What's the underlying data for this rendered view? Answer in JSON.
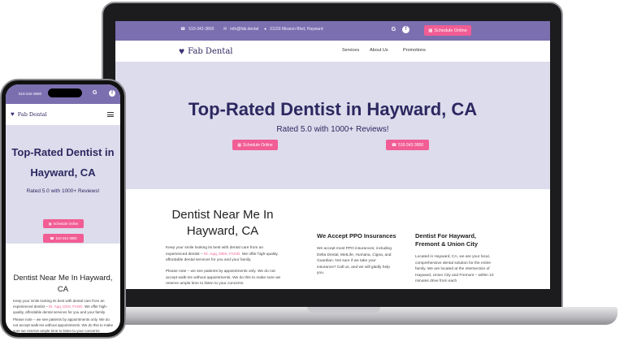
{
  "site": {
    "logo_name": "Fab Dental",
    "phone": "510-342-3800",
    "email": "info@fab.dental",
    "address": "31150 Mission Blvd, Hayward",
    "social": {
      "google": "G",
      "facebook": "f"
    },
    "schedule_label": "Schedule Online"
  },
  "nav": {
    "services": "Services",
    "about": "About Us",
    "promotions": "Promotions"
  },
  "hero": {
    "title": "Top-Rated Dentist in Hayward, CA",
    "title_line1": "Top-Rated Dentist in",
    "title_line2": "Hayward, CA",
    "subtitle": "Rated 5.0 with 1000+ Reviews!",
    "schedule_button": "Schedule Online",
    "phone_button": "510-342-3800"
  },
  "content": {
    "heading_line1": "Dentist Near Me In",
    "heading_line2": "Hayward, CA",
    "phone_heading_line1": "Dentist Near Me In Hayward,",
    "phone_heading_line2": "CA",
    "para1_a": "Keep your smile looking its best with dental care from an experienced dentist –",
    "para1_link": "Dr. Aqq, DDS, FAGD.",
    "para1_b": "We offer high-quality, affordable dental services for you and your family.",
    "para2": "Please note – we see patients by appointments only. We do not accept walk-ins without appointments. We do this to make sure we reserve ample time to listen to your concerns",
    "ppo_heading": "We Accept PPO Insurances",
    "ppo_text": "We accept most PPO insurances, including Delta Dental, MetLife, Humana, Cigna, and Guardian. Not sure if we take your insurance? Call us, and we will gladly help you.",
    "area_heading_line1": "Dentist For Hayward,",
    "area_heading_line2": "Fremont & Union City",
    "area_text": "Located in Hayward, CA, we are your local, comprehensive dental solution for the entire family. We are located at the intersection of Hayward, Union City and Fremont – within 10 minutes drive from each"
  },
  "colors": {
    "brand_purple": "#7c6fb0",
    "hero_bg": "#dcdcec",
    "heading_navy": "#2d2760",
    "accent_pink": "#f15d94"
  }
}
